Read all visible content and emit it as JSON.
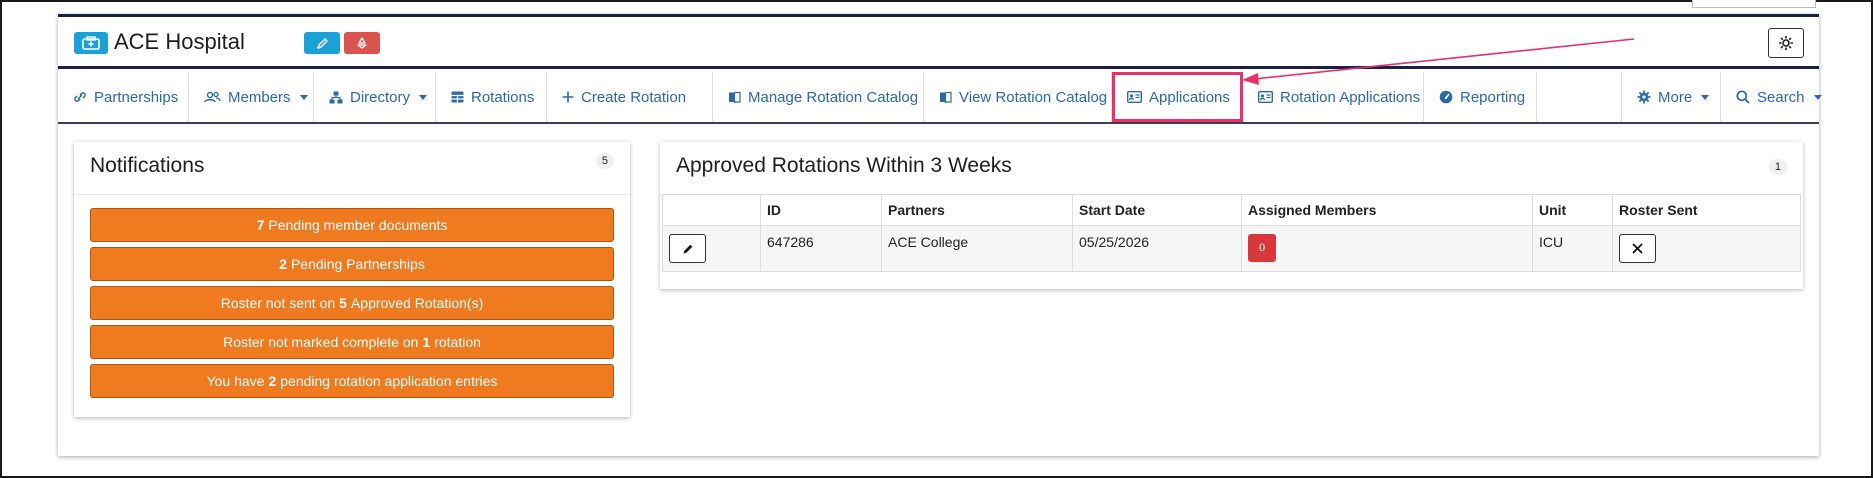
{
  "header": {
    "title": "ACE Hospital",
    "icons": {
      "hospital": "hospital-icon",
      "edit": "pencil-icon",
      "recycle": "recycle-icon",
      "settings": "gear-icon"
    }
  },
  "nav": {
    "items": [
      {
        "label": "Partnerships",
        "icon": "link-icon"
      },
      {
        "label": "Members",
        "icon": "users-icon",
        "dropdown": true
      },
      {
        "label": "Directory",
        "icon": "sitemap-icon",
        "dropdown": true
      },
      {
        "label": "Rotations",
        "icon": "table-icon"
      },
      {
        "label": "Create Rotation",
        "icon": "plus-icon"
      },
      {
        "label": "Manage Rotation Catalog",
        "icon": "book-icon"
      },
      {
        "label": "View Rotation Catalog",
        "icon": "book-icon"
      },
      {
        "label": "Applications",
        "icon": "id-card-icon",
        "highlighted": true
      },
      {
        "label": "Rotation Applications",
        "icon": "id-card-icon"
      },
      {
        "label": "Reporting",
        "icon": "gauge-icon"
      },
      {
        "label": "More",
        "icon": "gear-icon",
        "dropdown": true
      },
      {
        "label": "Search",
        "icon": "search-icon",
        "dropdown": true
      }
    ]
  },
  "notifications": {
    "title": "Notifications",
    "count": "5",
    "items": [
      {
        "bold": "7",
        "text": "Pending member documents"
      },
      {
        "bold": "2",
        "text": "Pending Partnerships"
      },
      {
        "prefix": "Roster not sent on",
        "bold": "5",
        "text": "Approved Rotation(s)"
      },
      {
        "prefix": "Roster not marked complete on",
        "bold": "1",
        "text": "rotation"
      },
      {
        "prefix": "You have",
        "bold": "2",
        "text": "pending rotation application entries"
      }
    ]
  },
  "approved_rotations": {
    "title": "Approved Rotations Within 3 Weeks",
    "count": "1",
    "columns": [
      "",
      "ID",
      "Partners",
      "Start Date",
      "Assigned Members",
      "Unit",
      "Roster Sent"
    ],
    "rows": [
      {
        "id": "647286",
        "partners": "ACE College",
        "start_date": "05/25/2026",
        "assigned_members": "0",
        "unit": "ICU"
      }
    ]
  },
  "colors": {
    "accent": "#1ba1d6",
    "danger": "#d9534f",
    "warning": "#f07a1f",
    "nav_text": "#2b6aa6",
    "highlight": "#e8316a",
    "navy": "#1c1f4a"
  }
}
